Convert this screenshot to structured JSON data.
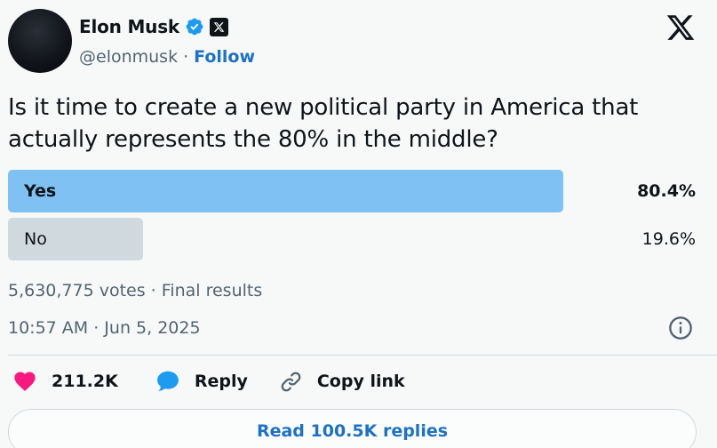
{
  "author": {
    "name": "Elon Musk",
    "handle": "@elonmusk",
    "separator": "·",
    "follow_label": "Follow"
  },
  "icons": {
    "verified": "verified-badge-icon",
    "affiliate": "x-affiliate-badge-icon",
    "brand": "x-logo-icon",
    "info": "info-icon",
    "like": "heart-icon",
    "reply": "speech-bubble-icon",
    "copy": "link-icon"
  },
  "tweet": {
    "text": "Is it time to create a new political party in America that actually represents the 80% in the middle?"
  },
  "poll": {
    "options": [
      {
        "label": "Yes",
        "percent_text": "80.4%",
        "percent": 80.4,
        "winner": true
      },
      {
        "label": "No",
        "percent_text": "19.6%",
        "percent": 19.6,
        "winner": false
      }
    ],
    "summary": "5,630,775 votes · Final results"
  },
  "timestamp": "10:57 AM · Jun 5, 2025",
  "actions": {
    "likes": "211.2K",
    "reply_label": "Reply",
    "copy_label": "Copy link"
  },
  "read_replies_label": "Read 100.5K replies",
  "colors": {
    "winner_bar": "#7fc1f3",
    "loser_bar": "#cfd9de",
    "link_blue": "#1d72c4",
    "verified_blue": "#1d9bf0",
    "heart_pink": "#f91880",
    "muted_text": "#536471",
    "background": "#f7f9f9"
  }
}
